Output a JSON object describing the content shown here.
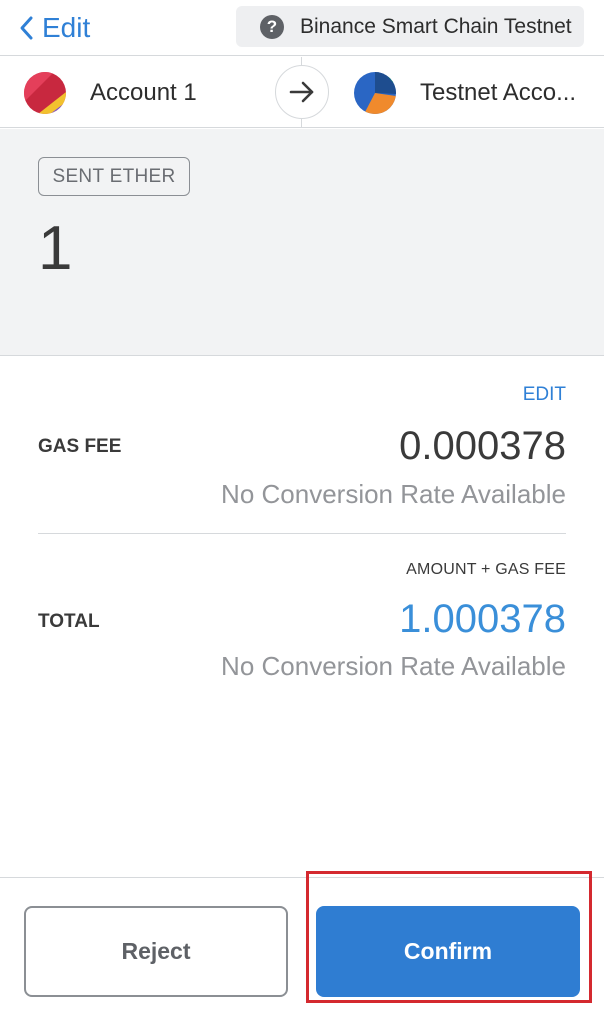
{
  "header": {
    "back_label": "Edit",
    "network_label": "Binance Smart Chain Testnet"
  },
  "accounts": {
    "from_name": "Account 1",
    "to_name": "Testnet Acco..."
  },
  "amount": {
    "badge": "SENT ETHER",
    "value": "1"
  },
  "gas": {
    "edit_label": "EDIT",
    "label": "GAS FEE",
    "value": "0.000378",
    "conversion": "No Conversion Rate Available"
  },
  "total": {
    "caption": "AMOUNT + GAS FEE",
    "label": "TOTAL",
    "value": "1.000378",
    "conversion": "No Conversion Rate Available"
  },
  "actions": {
    "reject_label": "Reject",
    "confirm_label": "Confirm"
  },
  "colors": {
    "accent": "#2f7dd2",
    "highlight": "#d4292f"
  }
}
